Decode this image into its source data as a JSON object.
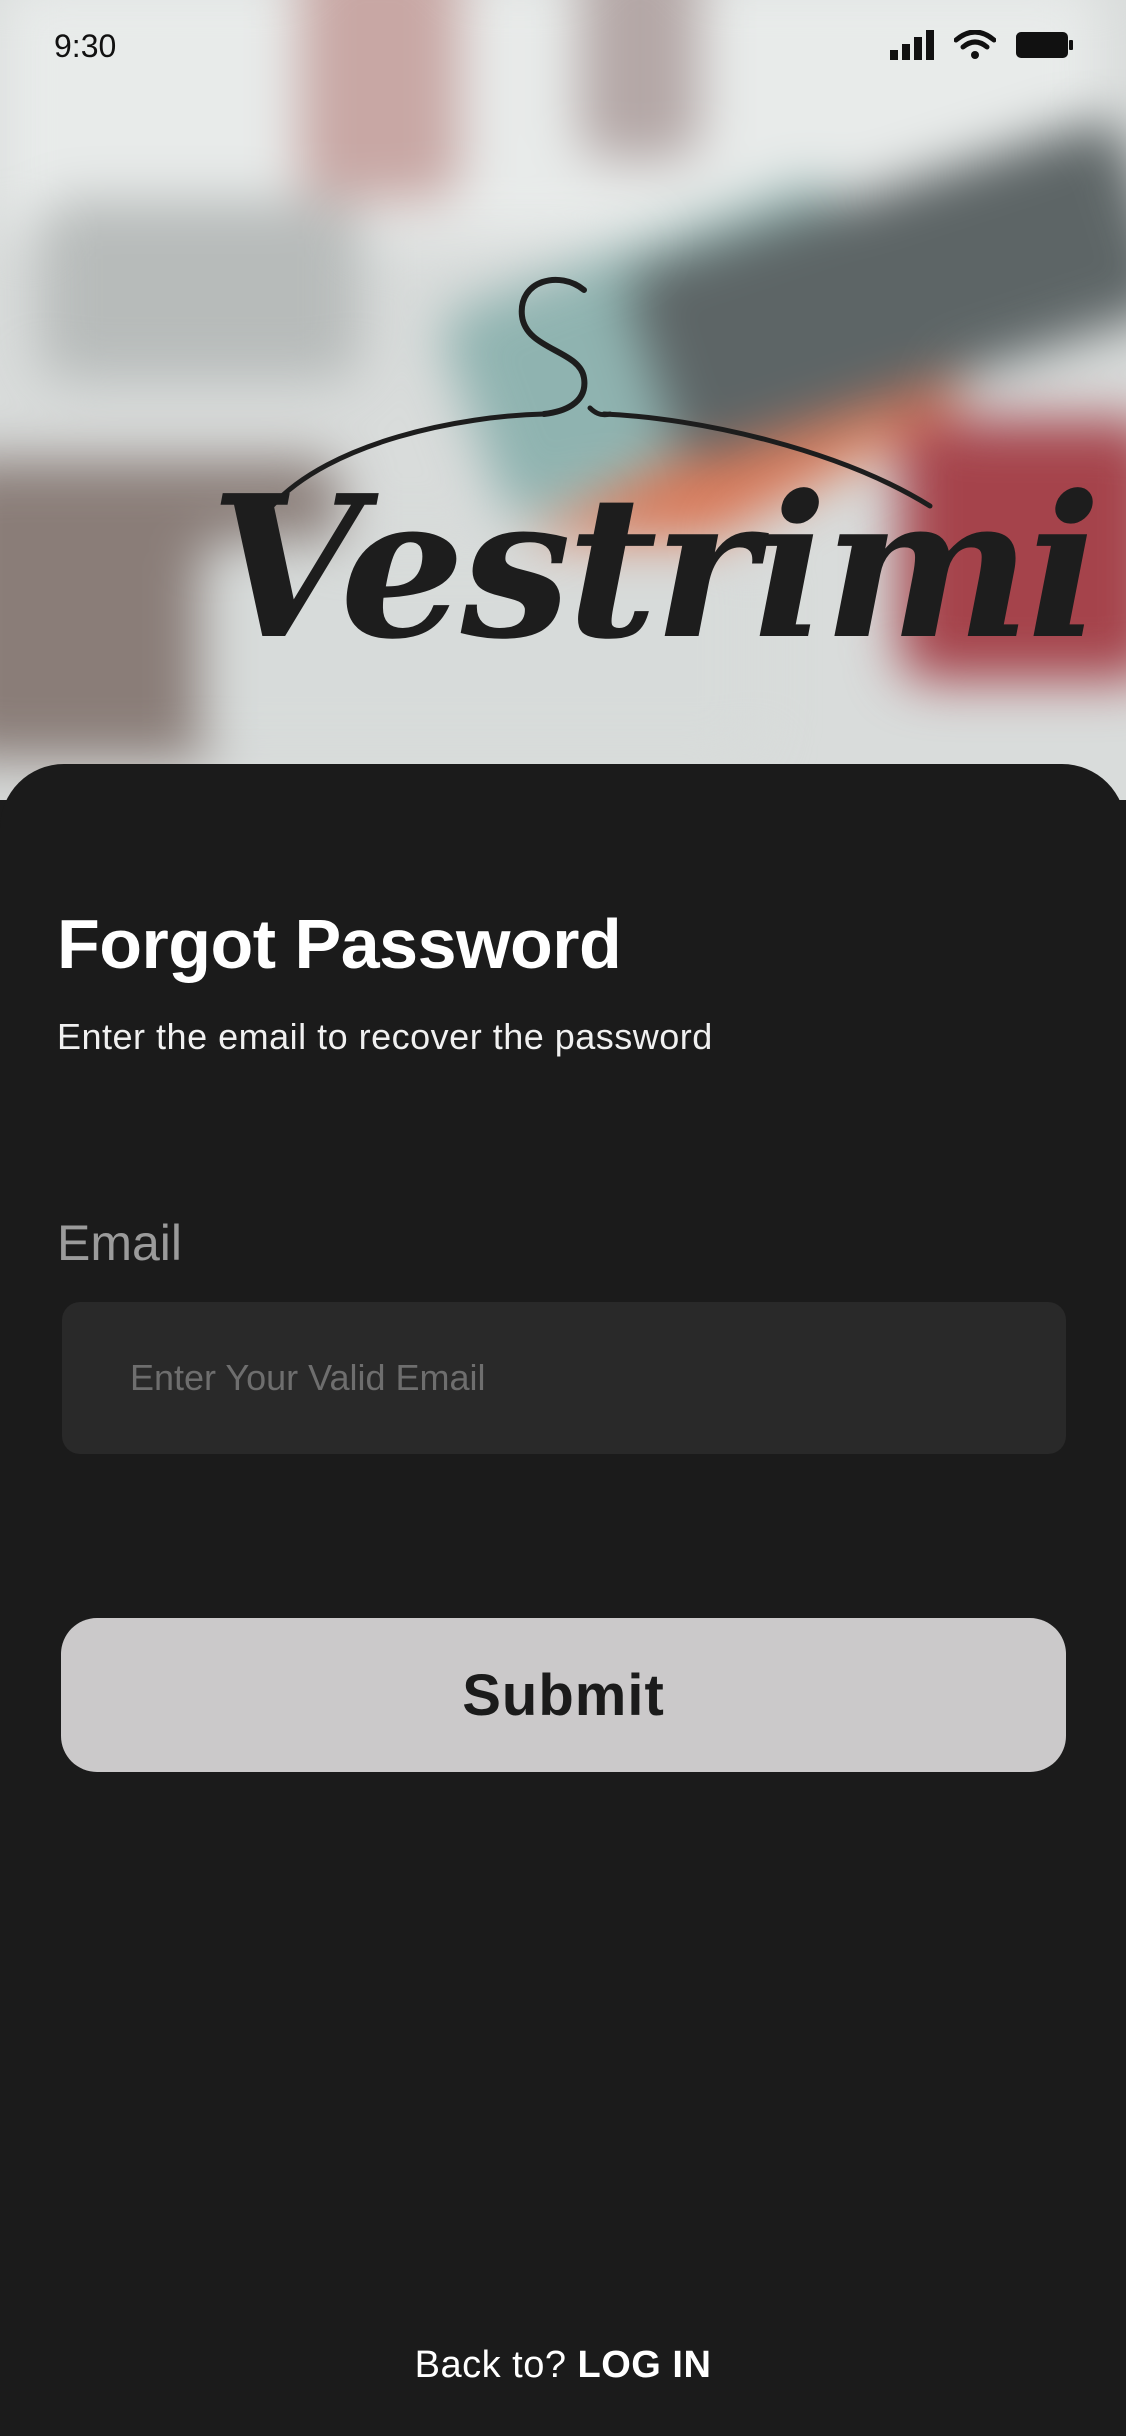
{
  "status_bar": {
    "time": "9:30"
  },
  "brand": {
    "logo_text": "Vestrimi"
  },
  "forgot": {
    "title": "Forgot Password",
    "subtitle": "Enter the email to recover the password"
  },
  "form": {
    "email_label": "Email",
    "email_value": "",
    "email_placeholder": "Enter Your Valid Email",
    "submit_label": "Submit"
  },
  "footer": {
    "back_text": "Back to? ",
    "login_label": "LOG IN"
  },
  "colors": {
    "sheet_background": "#1b1b1b",
    "input_background": "#292929",
    "button_background": "#cbc9ca",
    "button_text": "#1b1b1b",
    "label_grey": "#9b9b9b",
    "placeholder_grey": "#6e6e6e"
  },
  "icons": {
    "signal": "cellular-signal-icon",
    "wifi": "wifi-icon",
    "battery": "battery-icon",
    "logo": "hanger-logo-icon"
  }
}
